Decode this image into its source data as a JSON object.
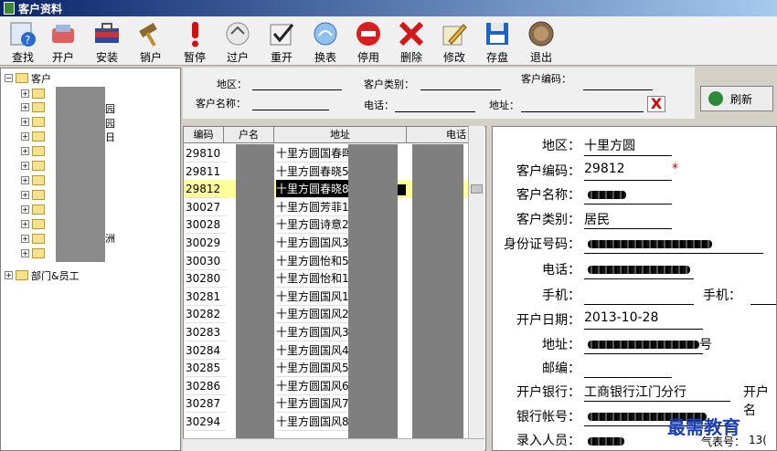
{
  "window": {
    "title": "客户资料"
  },
  "toolbar": {
    "buttons": [
      {
        "label": "查找"
      },
      {
        "label": "开户"
      },
      {
        "label": "安装"
      },
      {
        "label": "销户"
      },
      {
        "label": "暂停"
      },
      {
        "label": "过户"
      },
      {
        "label": "重开"
      },
      {
        "label": "换表"
      },
      {
        "label": "停用"
      },
      {
        "label": "删除"
      },
      {
        "label": "修改"
      },
      {
        "label": "存盘"
      },
      {
        "label": "退出"
      }
    ]
  },
  "tree": {
    "root_label": "客户",
    "child_partial_labels": [
      "园",
      "园",
      "日",
      "洲"
    ],
    "other_label": "部门&员工"
  },
  "filter": {
    "area_label": "地区：",
    "category_label": "客户类别：",
    "code_label": "客户编码：",
    "name_label": "客户名称：",
    "phone_label": "电话：",
    "address_label": "地址：",
    "clear_label": "X"
  },
  "refresh": {
    "label": "刷新"
  },
  "grid": {
    "columns": [
      "编码",
      "户名",
      "地址",
      "电话"
    ],
    "rows": [
      {
        "code": "29810",
        "address": "十里方圆国春晖"
      },
      {
        "code": "29811",
        "address": "十里方圆春晓5"
      },
      {
        "code": "29812",
        "address": "十里方圆春晓8"
      },
      {
        "code": "30027",
        "address": "十里方圆芳菲1"
      },
      {
        "code": "30028",
        "address": "十里方圆诗意2"
      },
      {
        "code": "30029",
        "address": "十里方圆国风3"
      },
      {
        "code": "30030",
        "address": "十里方圆怡和5"
      },
      {
        "code": "30280",
        "address": "十里方圆怡和1"
      },
      {
        "code": "30281",
        "address": "十里方圆国风1"
      },
      {
        "code": "30282",
        "address": "十里方圆国风2"
      },
      {
        "code": "30283",
        "address": "十里方圆国风3"
      },
      {
        "code": "30284",
        "address": "十里方圆国风4"
      },
      {
        "code": "30285",
        "address": "十里方圆国风5"
      },
      {
        "code": "30286",
        "address": "十里方圆国风6"
      },
      {
        "code": "30287",
        "address": "十里方圆国风7"
      },
      {
        "code": "30294",
        "address": "十里方圆国风8"
      }
    ],
    "selected_index": 2
  },
  "detail": {
    "area_label": "地区：",
    "area_value": "十里方圆",
    "code_label": "客户编码：",
    "code_value": "29812",
    "required_mark": "*",
    "name_label": "客户名称：",
    "category_label": "客户类别：",
    "category_value": "居民",
    "id_label": "身份证号码：",
    "phone_label": "电话：",
    "mobile_label": "手机：",
    "mobile2_label": "手机：",
    "open_date_label": "开户日期：",
    "open_date_value": "2013-10-28",
    "address_label": "地址：",
    "address_suffix": "号",
    "zip_label": "邮编：",
    "bank_label": "开户银行：",
    "bank_value": "工商银行江门分行",
    "bank2_label": "开户名",
    "account_label": "银行帐号：",
    "entry_label": "录入人员：",
    "meter_label": "气表号：",
    "meter_value": "13("
  },
  "watermark": {
    "text": "最需教育"
  },
  "colors": {
    "title_bar": "#0a246a",
    "selected_row": "#ffff99",
    "required": "#d00000"
  }
}
